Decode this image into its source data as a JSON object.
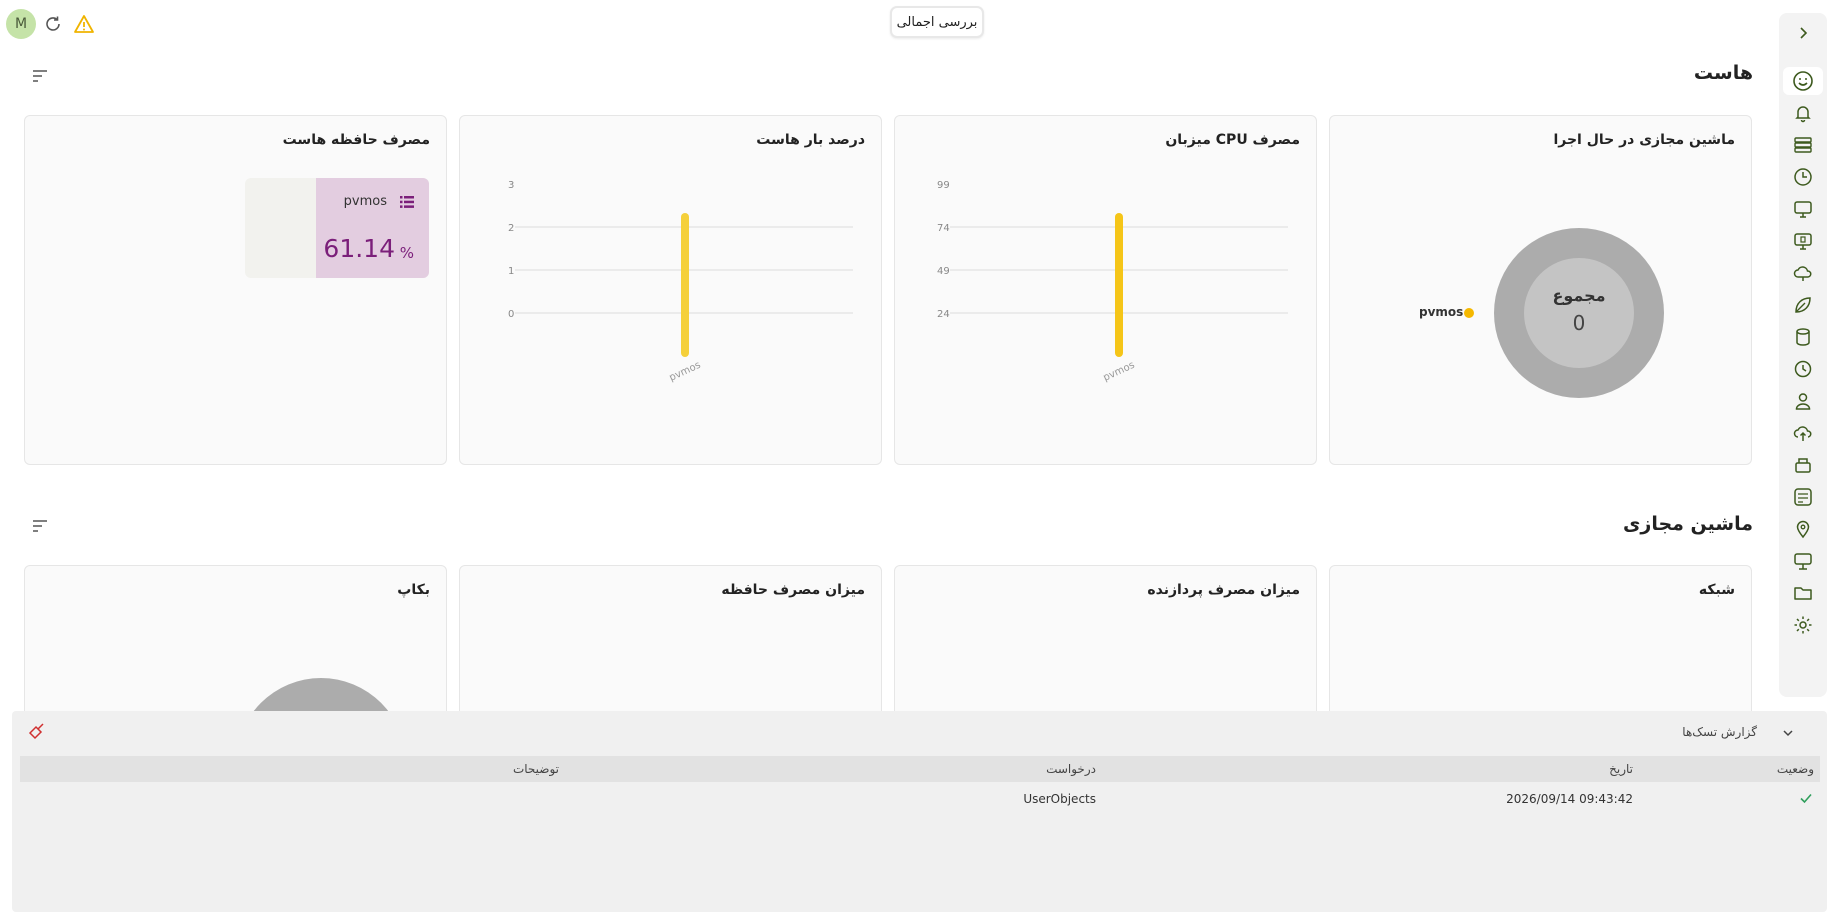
{
  "header": {
    "avatar_letter": "M",
    "overview_tab": "بررسی اجمالی"
  },
  "host_section": {
    "title": "هاست",
    "cards": {
      "running_vms": {
        "title": "ماشین مجازی در حال اجرا",
        "center_label": "مجموع",
        "center_value": "0",
        "legend": "pvmos"
      },
      "cpu_usage": {
        "title": "مصرف CPU میزبان",
        "y_ticks": [
          "99",
          "74",
          "49",
          "24"
        ],
        "x_label": "pvmos"
      },
      "host_load": {
        "title": "درصد بار هاست",
        "y_ticks": [
          "3",
          "2",
          "1",
          "0"
        ],
        "x_label": "pvmos"
      },
      "memory_usage": {
        "title": "مصرف حافظه هاست",
        "host_name": "pvmos",
        "value": "61.14",
        "unit": "%"
      }
    }
  },
  "vm_section": {
    "title": "ماشین مجازی",
    "cards": {
      "network": {
        "title": "شبکه"
      },
      "cpu": {
        "title": "میزان مصرف پردازنده"
      },
      "memory": {
        "title": "میزان مصرف حافظه"
      },
      "backup": {
        "title": "بکاپ"
      }
    }
  },
  "task_panel": {
    "title": "گزارش تسک‌ها",
    "columns": {
      "status": "وضعیت",
      "date": "تاریخ",
      "request": "درخواست",
      "description": "توضیحات"
    },
    "rows": [
      {
        "status": "success",
        "date": "2026/09/14 09:43:42",
        "request": "UserObjects",
        "description": ""
      }
    ]
  },
  "colors": {
    "accent_yellow": "#f5c518",
    "memory_purple": "#7b1f7a",
    "memory_bg": "#e3cde0",
    "success_green": "#2e9e5b",
    "icon_green": "#3d5a1e"
  }
}
